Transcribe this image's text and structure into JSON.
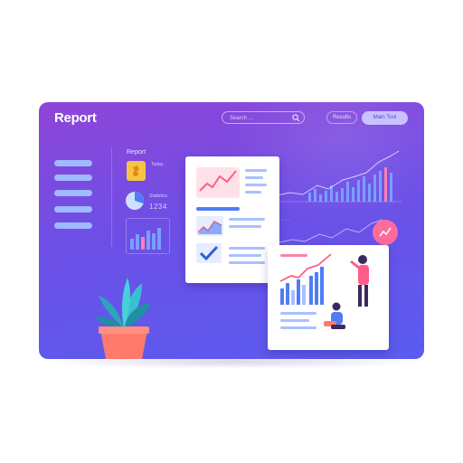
{
  "header": {
    "title": "Report",
    "search_placeholder": "Search ...",
    "nav_link": "Results",
    "nav_button": "Main Tool"
  },
  "sidebar": {
    "items": [
      "",
      "",
      "",
      "",
      ""
    ]
  },
  "widgets": {
    "report_label": "Report",
    "tag_label": "Today",
    "stat_caption": "Statistics",
    "stat_number": "1234"
  },
  "colors": {
    "panel_start": "#8f45d8",
    "panel_end": "#5a5cf0",
    "accent_pink": "#ff6b9a",
    "accent_blue": "#4f7df5",
    "chart_blue": "#6d8ff7",
    "pot_coral": "#ff7a6b",
    "leaf_teal": "#32b3c4",
    "check_blue": "#2f5fd8"
  },
  "icons": [
    "search-icon",
    "ticket-icon",
    "pie-chart-icon",
    "bar-chart-icon",
    "line-chart-icon",
    "check-icon",
    "plant-icon",
    "person-icon"
  ]
}
